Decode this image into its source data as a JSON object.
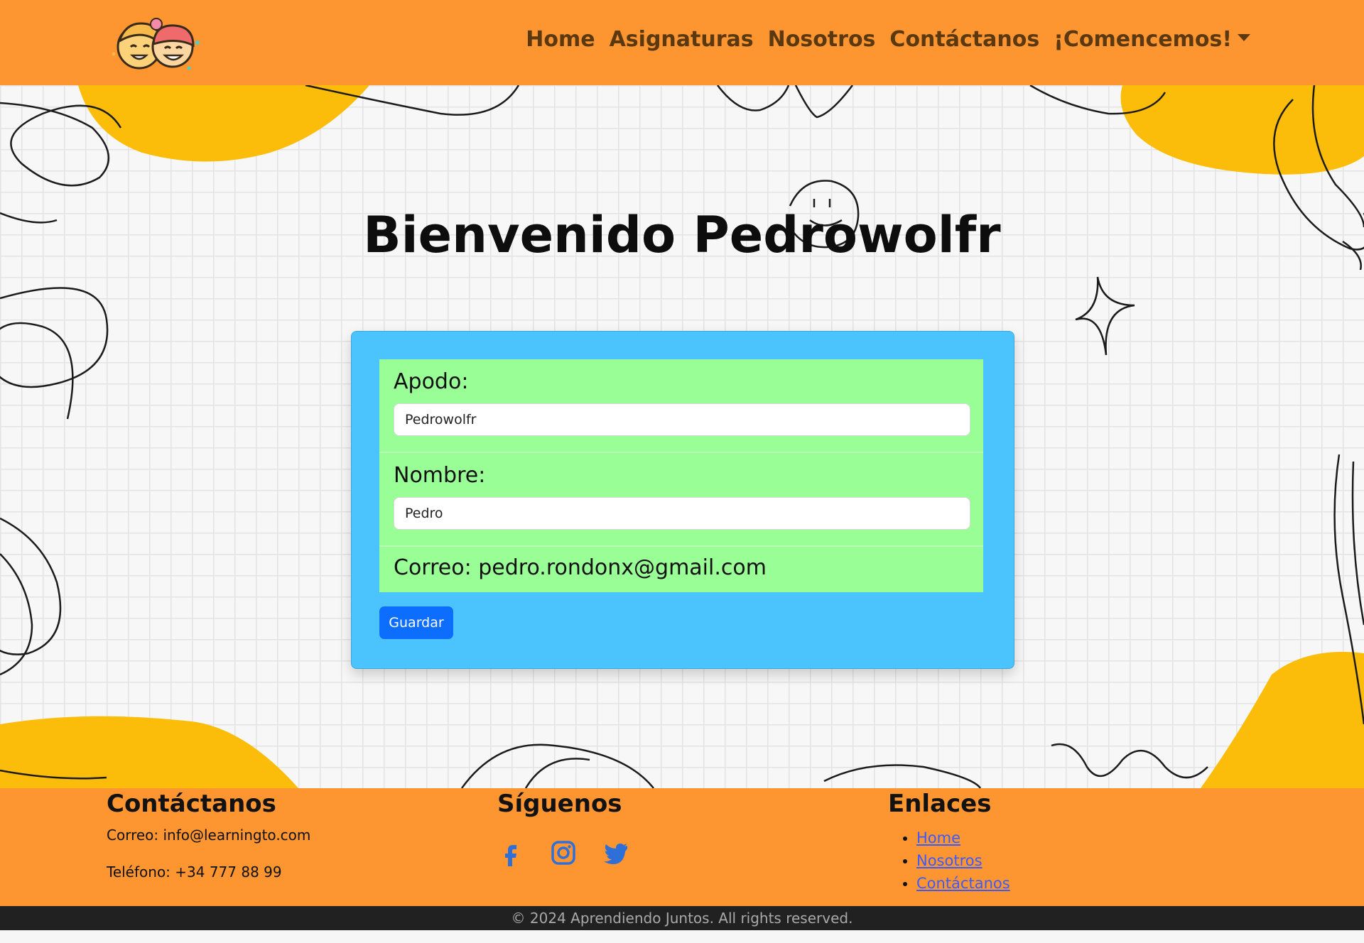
{
  "nav": {
    "items": [
      "Home",
      "Asignaturas",
      "Nosotros",
      "Contáctanos",
      "¡Comencemos!"
    ]
  },
  "main": {
    "welcome": "Bienvenido Pedrowolfr",
    "form": {
      "apodo_label": "Apodo:",
      "apodo_value": "Pedrowolfr",
      "nombre_label": "Nombre:",
      "nombre_value": "Pedro",
      "correo_text": "Correo: pedro.rondonx@gmail.com",
      "save_label": "Guardar"
    }
  },
  "footer": {
    "contact_title": "Contáctanos",
    "contact_email": "Correo: info@learningto.com",
    "contact_phone": "Teléfono: +34 777 88 99",
    "follow_title": "Síguenos",
    "social_icons": [
      "facebook-icon",
      "instagram-icon",
      "twitter-icon"
    ],
    "links_title": "Enlaces",
    "links": [
      "Home",
      "Nosotros",
      "Contáctanos"
    ],
    "copyright": "© 2024 Aprendiendo Juntos. All rights reserved."
  },
  "colors": {
    "nav_bg": "#fd9531",
    "card_bg": "#4bc4fe",
    "field_bg": "#9afe96",
    "button_bg": "#0d6efd",
    "blob": "#fbbd0a"
  }
}
